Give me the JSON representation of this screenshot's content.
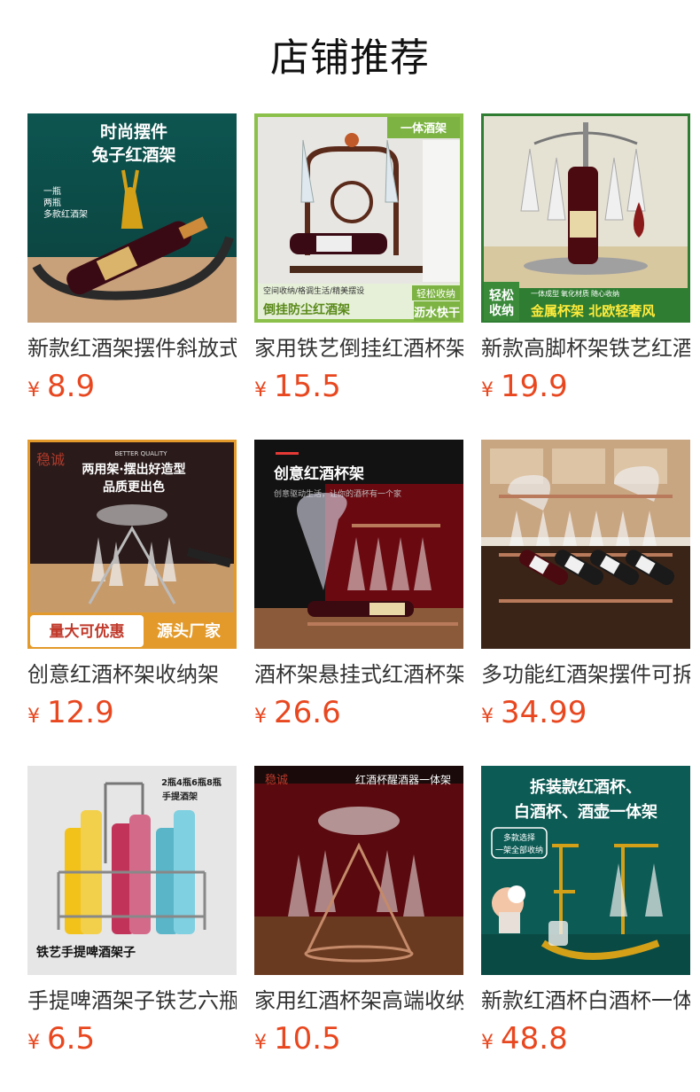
{
  "section_title": "店铺推荐",
  "currency_symbol": "¥",
  "products": [
    {
      "name": "新款红酒架摆件斜放式",
      "price": "8.9",
      "image_text": [
        "时尚摆件",
        "兔子红酒架",
        "一瓶",
        "两瓶",
        "多款红酒架"
      ]
    },
    {
      "name": "家用铁艺倒挂红酒杯架",
      "price": "15.5",
      "image_text": [
        "一体酒架",
        "空间收纳/格调生活/精美摆设",
        "轻松收纳",
        "倒挂防尘红酒架",
        "沥水快干"
      ]
    },
    {
      "name": "新款高脚杯架铁艺红酒",
      "price": "19.9",
      "image_text": [
        "轻松",
        "收纳",
        "一体成型",
        "氧化材质",
        "随心收纳",
        "金属杯架 北欧轻奢风"
      ]
    },
    {
      "name": "创意红酒杯架收纳架",
      "price": "12.9",
      "image_text": [
        "稳诚",
        "BETTER QUALITY",
        "两用架·摆出好造型",
        "品质更出色",
        "量大可优惠",
        "源头厂家"
      ]
    },
    {
      "name": "酒杯架悬挂式红酒杯架",
      "price": "26.6",
      "image_text": [
        "创意红酒杯架",
        "创意驱动生活，让你的酒杯有一个家"
      ]
    },
    {
      "name": "多功能红酒架摆件可拆",
      "price": "34.99",
      "image_text": []
    },
    {
      "name": "手提啤酒架子铁艺六瓶",
      "price": "6.5",
      "image_text": [
        "2瓶4瓶6瓶8瓶",
        "手提酒架",
        "铁艺手提啤酒架子"
      ]
    },
    {
      "name": "家用红酒杯架高端收纳",
      "price": "10.5",
      "image_text": [
        "稳诚",
        "红酒杯醒酒器一体架"
      ]
    },
    {
      "name": "新款红酒杯白酒杯一体",
      "price": "48.8",
      "image_text": [
        "拆装款红酒杯、",
        "白酒杯、酒壶一体架",
        "多款选择",
        "一架全部收纳"
      ]
    }
  ],
  "colors": {
    "price": "#e8471f",
    "title": "#111111",
    "name": "#333333"
  }
}
